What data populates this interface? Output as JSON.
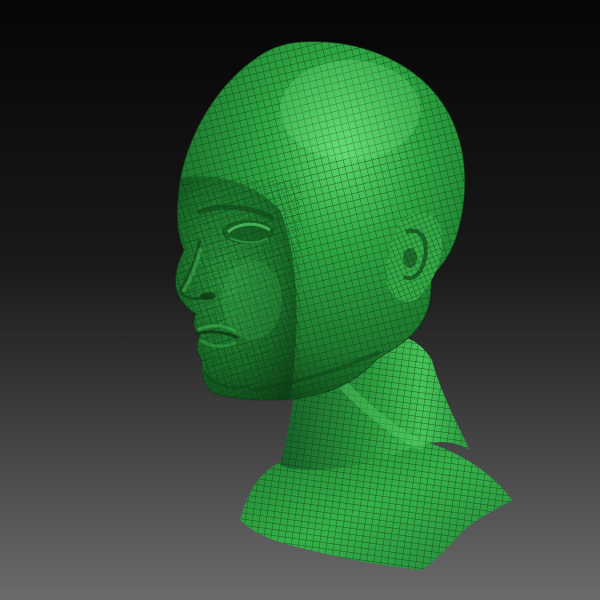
{
  "viewport": {
    "subject": "head-bust-icon",
    "background_top": "#050505",
    "background_bottom": "#6a6a6a",
    "mesh_base": "#2a9a3c",
    "mesh_highlight": "#57d26a",
    "mesh_shadow": "#0f4a1b",
    "wire_color": "#0c3a14"
  }
}
